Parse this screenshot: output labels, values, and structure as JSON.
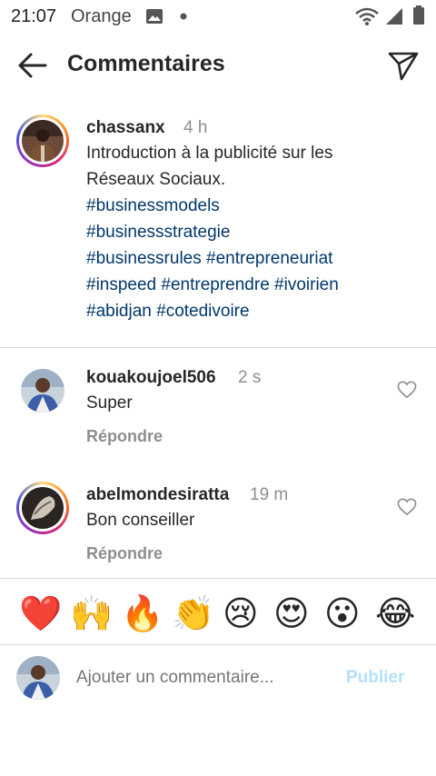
{
  "status": {
    "time": "21:07",
    "carrier": "Orange"
  },
  "header": {
    "title": "Commentaires"
  },
  "post": {
    "username": "chassanx",
    "time": "4 h",
    "text_line1": "Introduction à la publicité sur les",
    "text_line2": "Réseaux Sociaux.",
    "tags_line1": "#businessmodels",
    "tags_line2": "#businessstrategie",
    "tags_line3": "#businessrules #entrepreneuriat",
    "tags_line4": "#inspeed  #entreprendre #ivoirien",
    "tags_line5": "#abidjan #cotedivoire"
  },
  "comments": [
    {
      "username": "kouakoujoel506",
      "time": "2 s",
      "text": "Super",
      "reply_label": "Répondre"
    },
    {
      "username": "abelmondesiratta",
      "time": "19 m",
      "text": "Bon conseiller",
      "reply_label": "Répondre"
    }
  ],
  "reactions": [
    "❤️",
    "🙌",
    "🔥",
    "👏",
    "😢",
    "😍",
    "😮",
    "😂"
  ],
  "composer": {
    "placeholder": "Ajouter un commentaire...",
    "publish_label": "Publier"
  },
  "colors": {
    "link": "#00376b",
    "muted": "#8e8e8e",
    "publish": "#b2dffc",
    "divider": "#dbdbdb"
  }
}
